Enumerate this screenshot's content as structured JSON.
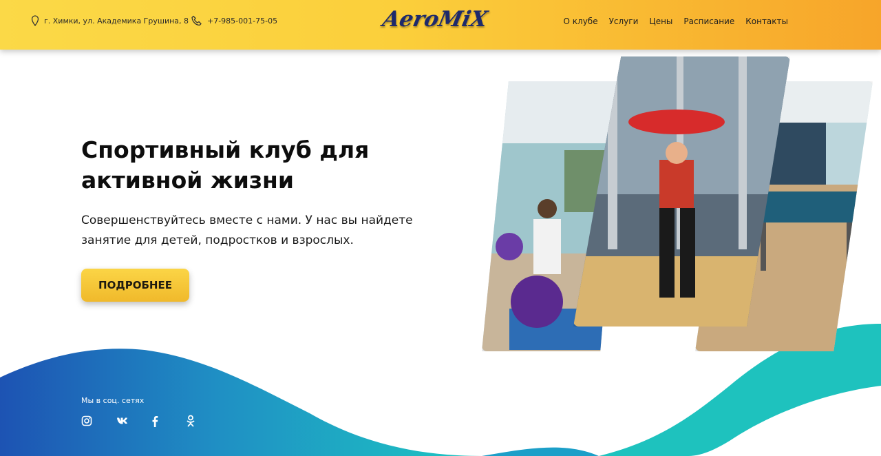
{
  "header": {
    "address": "г. Химки, ул. Академика Грушина, 8",
    "phone": "+7-985-001-75-05",
    "logo": "AeroMiX",
    "nav": [
      "О клубе",
      "Услуги",
      "Цены",
      "Расписание",
      "Контакты"
    ]
  },
  "hero": {
    "title": "Спортивный клуб для активной жизни",
    "subtitle": "Совершенствуйтесь вместе с нами. У нас вы найдете занятие для детей, подростков и взрослых.",
    "button": "ПОДРОБНЕЕ"
  },
  "social": {
    "label": "Мы в соц. сетях",
    "icons": [
      "instagram-icon",
      "vk-icon",
      "facebook-icon",
      "odnoklassniki-icon"
    ]
  },
  "colors": {
    "header_left": "#fbd947",
    "header_right": "#f7a52a",
    "button": "#f5c73a",
    "wave_blue": "#1f5bb5",
    "wave_teal": "#1fc0c0"
  }
}
